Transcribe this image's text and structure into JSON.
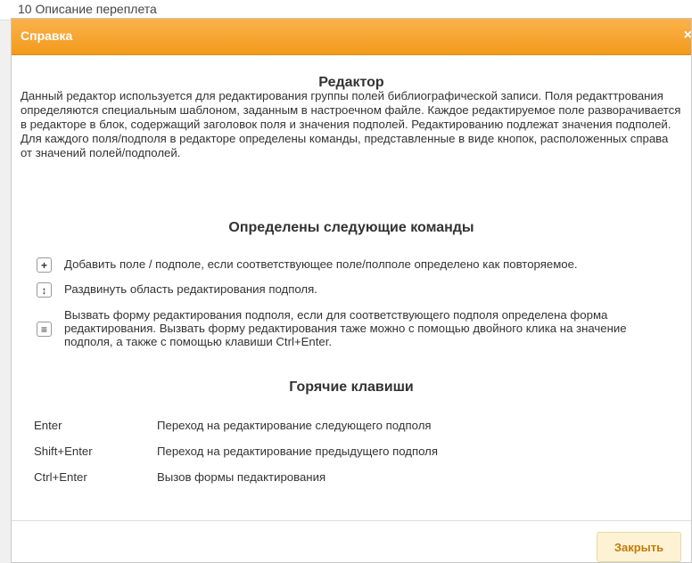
{
  "background": {
    "text": "10 Описание переплета"
  },
  "dialog": {
    "title": "Справка",
    "close_glyph": "×"
  },
  "sections": {
    "editor_heading": "Редактор",
    "editor_text": "Данный редактор используется для редактирования группы полей библиографической записи. Поля редакттрования определяются специальным шаблоном, заданным в настроечном файле. Каждое редактируемое поле разворачивается в редакторе в блок, содержащий заголовок поля и значения подполей. Редактированию подлежат значения подполей. Для каждого поля/подполя в редакторе определены команды, представленные в виде кнопок, расположенных справа от значений полей/подполей.",
    "commands_heading": "Определены следующие команды",
    "commands": [
      {
        "icon": "plus-icon",
        "glyph": "+",
        "text": "Добавить поле / подполе, если соответствующее поле/полполе определено как повторяемое."
      },
      {
        "icon": "expand-vertical-icon",
        "glyph": "↕",
        "text": "Раздвинуть область редактирования подполя."
      },
      {
        "icon": "menu-icon",
        "glyph": "≡",
        "text": "Вызвать форму редактирования подполя, если для соответствующего подполя определена форма редактирования. Вызвать форму редактирования таже можно с помощью двойного клика на значение подполя, а также с помощью клавиши Ctrl+Enter."
      }
    ],
    "hotkeys_heading": "Горячие клавиши",
    "hotkeys": [
      {
        "key": "Enter",
        "desc": "Переход на редактирование следующего подполя"
      },
      {
        "key": "Shift+Enter",
        "desc": "Переход на редактирование предыдущего подполя"
      },
      {
        "key": "Ctrl+Enter",
        "desc": "Вызов формы педактирования"
      }
    ]
  },
  "footer": {
    "close_label": "Закрыть"
  },
  "colors": {
    "accent": "#f29a1c",
    "button_bg": "#fdf3d4",
    "button_text": "#c47a0a"
  }
}
